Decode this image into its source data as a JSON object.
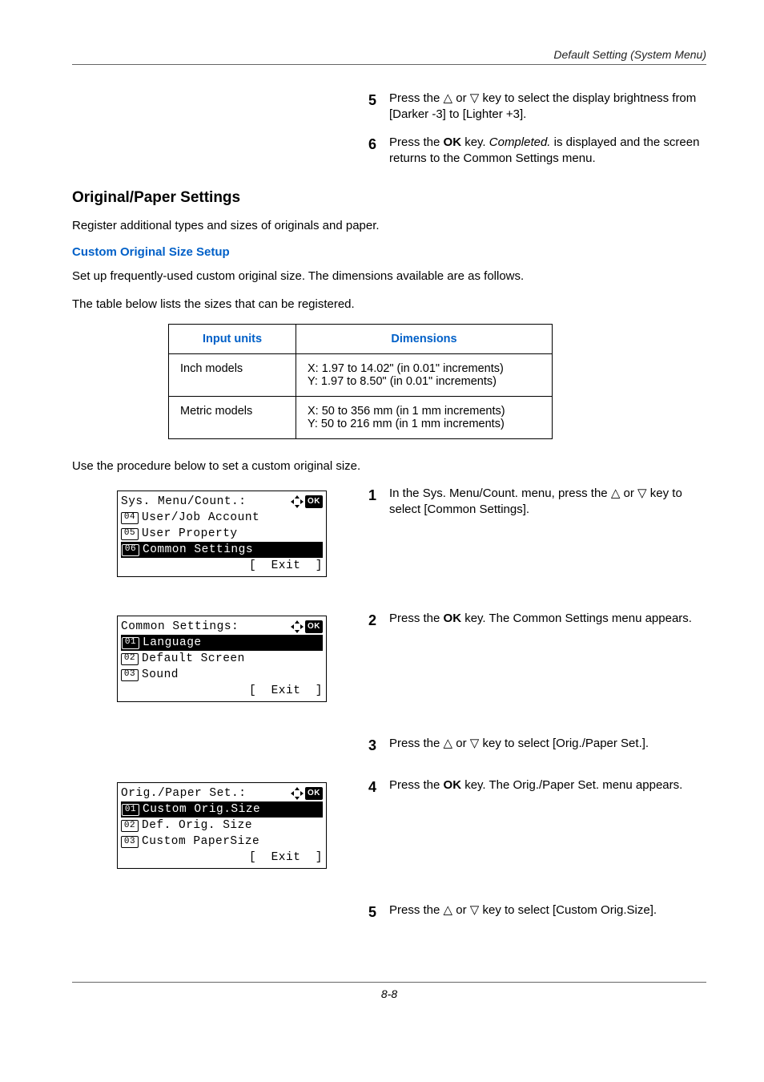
{
  "header": {
    "title": "Default Setting (System Menu)"
  },
  "top_steps": [
    {
      "num": "5",
      "text_before": "Press the ",
      "sym1": "△",
      "text_mid1": " or ",
      "sym2": "▽",
      "text_after": " key to select the display brightness from [Darker -3] to [Lighter +3]."
    },
    {
      "num": "6",
      "text_before": "Press the ",
      "bold": "OK",
      "text_mid1": " key. ",
      "italic": "Completed.",
      "text_after": " is displayed and the screen returns to the Common Settings menu."
    }
  ],
  "section": {
    "title": "Original/Paper Settings",
    "intro": "Register additional types and sizes of originals and paper.",
    "subhead": "Custom Original Size Setup",
    "p1": "Set up frequently-used custom original size. The dimensions available are as follows.",
    "p2": "The table below lists the sizes that can be registered."
  },
  "table": {
    "col1": "Input units",
    "col2": "Dimensions",
    "rows": [
      {
        "units": "Inch models",
        "dim": "X: 1.97 to 14.02\" (in 0.01\" increments)\nY: 1.97 to 8.50\" (in 0.01\" increments)"
      },
      {
        "units": "Metric models",
        "dim": "X: 50 to 356 mm (in 1 mm increments)\nY: 50 to 216 mm (in 1 mm increments)"
      }
    ]
  },
  "intro2": "Use the procedure below to set a custom original size.",
  "lcd1": {
    "title": "Sys. Menu/Count.:",
    "title_suffix": "a b",
    "items": [
      {
        "n": "04",
        "label": "User/Job Account",
        "sel": false
      },
      {
        "n": "05",
        "label": "User Property",
        "sel": false
      },
      {
        "n": "06",
        "label": "Common Settings",
        "sel": true
      }
    ],
    "foot": "[  Exit  ]"
  },
  "lcd2": {
    "title": "Common Settings:",
    "title_suffix": "a b",
    "items": [
      {
        "n": "01",
        "label": "Language",
        "sel": true
      },
      {
        "n": "02",
        "label": "Default Screen",
        "sel": false
      },
      {
        "n": "03",
        "label": "Sound",
        "sel": false
      }
    ],
    "foot": "[  Exit  ]"
  },
  "lcd3": {
    "title": "Orig./Paper Set.:",
    "title_suffix": "a b",
    "items": [
      {
        "n": "01",
        "label": "Custom Orig.Size",
        "sel": true
      },
      {
        "n": "02",
        "label": "Def. Orig. Size",
        "sel": false
      },
      {
        "n": "03",
        "label": "Custom PaperSize",
        "sel": false
      }
    ],
    "foot": "[  Exit  ]"
  },
  "main_steps": {
    "s1": {
      "num": "1",
      "pre": "In the Sys. Menu/Count. menu, press the ",
      "s1": "△",
      "mid1": " or ",
      "s2": "▽",
      "post": " key to select [Common Settings]."
    },
    "s2": {
      "num": "2",
      "pre": "Press the ",
      "b": "OK",
      "post": " key. The Common Settings menu appears."
    },
    "s3": {
      "num": "3",
      "pre": "Press the ",
      "s1": "△",
      "mid1": " or ",
      "s2": "▽",
      "post": " key to select [Orig./Paper Set.]."
    },
    "s4": {
      "num": "4",
      "pre": "Press the ",
      "b": "OK",
      "post": " key. The Orig./Paper Set. menu appears."
    },
    "s5": {
      "num": "5",
      "pre": "Press the ",
      "s1": "△",
      "mid1": " or ",
      "s2": "▽",
      "post": " key to select [Custom Orig.Size]."
    }
  },
  "footer": {
    "page": "8-8"
  }
}
